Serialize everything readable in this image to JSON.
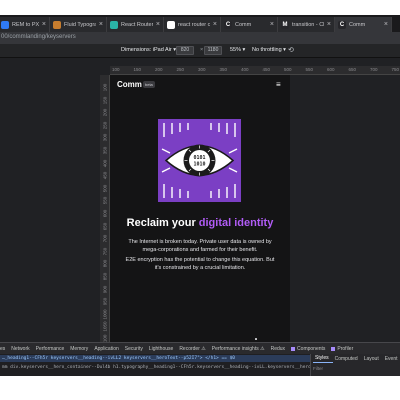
{
  "tabs": [
    {
      "title": "REM to PX co",
      "icon": "converter-favicon",
      "color": "#2f7bf5",
      "glyph": ""
    },
    {
      "title": "Fluid Typogra",
      "icon": "document-favicon",
      "color": "#c77d2e",
      "glyph": ""
    },
    {
      "title": "React Router",
      "icon": "react-router-favicon",
      "color": "#2ab3a6",
      "glyph": ""
    },
    {
      "title": "react router c",
      "icon": "google-favicon",
      "color": "#ffffff",
      "glyph": ""
    },
    {
      "title": "Comm",
      "icon": "comm-favicon",
      "color": "#26262a",
      "glyph": "C"
    },
    {
      "title": "transition - Cl",
      "icon": "m-favicon",
      "color": "#26262a",
      "glyph": "M"
    },
    {
      "title": "Comm",
      "icon": "comm-favicon",
      "color": "#26262a",
      "glyph": "C"
    }
  ],
  "address": {
    "url": "00/commlanding/keyservers"
  },
  "device_toolbar": {
    "dimensions": "Dimensions: iPad Air ▾",
    "width": "820",
    "times": "×",
    "height": "1180",
    "zoom": "55% ▾",
    "throttling": "No throttling ▾"
  },
  "ruler": {
    "h": [
      "100",
      "150",
      "200",
      "250",
      "300",
      "350",
      "400",
      "450",
      "500",
      "550",
      "600",
      "650",
      "700",
      "750"
    ],
    "v": [
      "100",
      "150",
      "200",
      "250",
      "300",
      "350",
      "400",
      "450",
      "500",
      "550",
      "600",
      "650",
      "700",
      "750",
      "800",
      "850",
      "900",
      "950",
      "1000",
      "1050",
      "1100",
      "1150"
    ]
  },
  "page": {
    "logo": "Comm",
    "beta": "beta",
    "menu": "≡",
    "heading_plain": "Reclaim your ",
    "heading_accent": "digital identity",
    "para1": "The Internet is broken today. Private user data is owned by mega-corporations and farmed for their benefit.",
    "para2": "E2E encryption has the potential to change this equation. But it's constrained by a crucial limitation.",
    "art": {
      "bits_top": "0101",
      "bits_bottom": "1010"
    }
  },
  "devtools": {
    "panels": [
      "es",
      "Network",
      "Performance",
      "Memory",
      "Application",
      "Security",
      "Lighthouse",
      "Recorder ⚠",
      "Performance insights ⚠",
      "Redux",
      "Components",
      "Profiler"
    ],
    "code_line": "…_heading1--CFh5r keyservers__heading--ivLL2 keyservers__heroText--p52I7\"> </h1> == $0",
    "breadcrumbs": "mm  div.keyservers__hero_container--Dul4b  h1.typography__heading1--CFh5r.keyservers__heading--ivLL.keyservers__heroText--p5zI7",
    "side_tabs": [
      "Styles",
      "Computed",
      "Layout",
      "Event"
    ],
    "filter": "Filter"
  },
  "colors": {
    "accent": "#b15cf6",
    "art_purple": "#7b3fc4"
  }
}
